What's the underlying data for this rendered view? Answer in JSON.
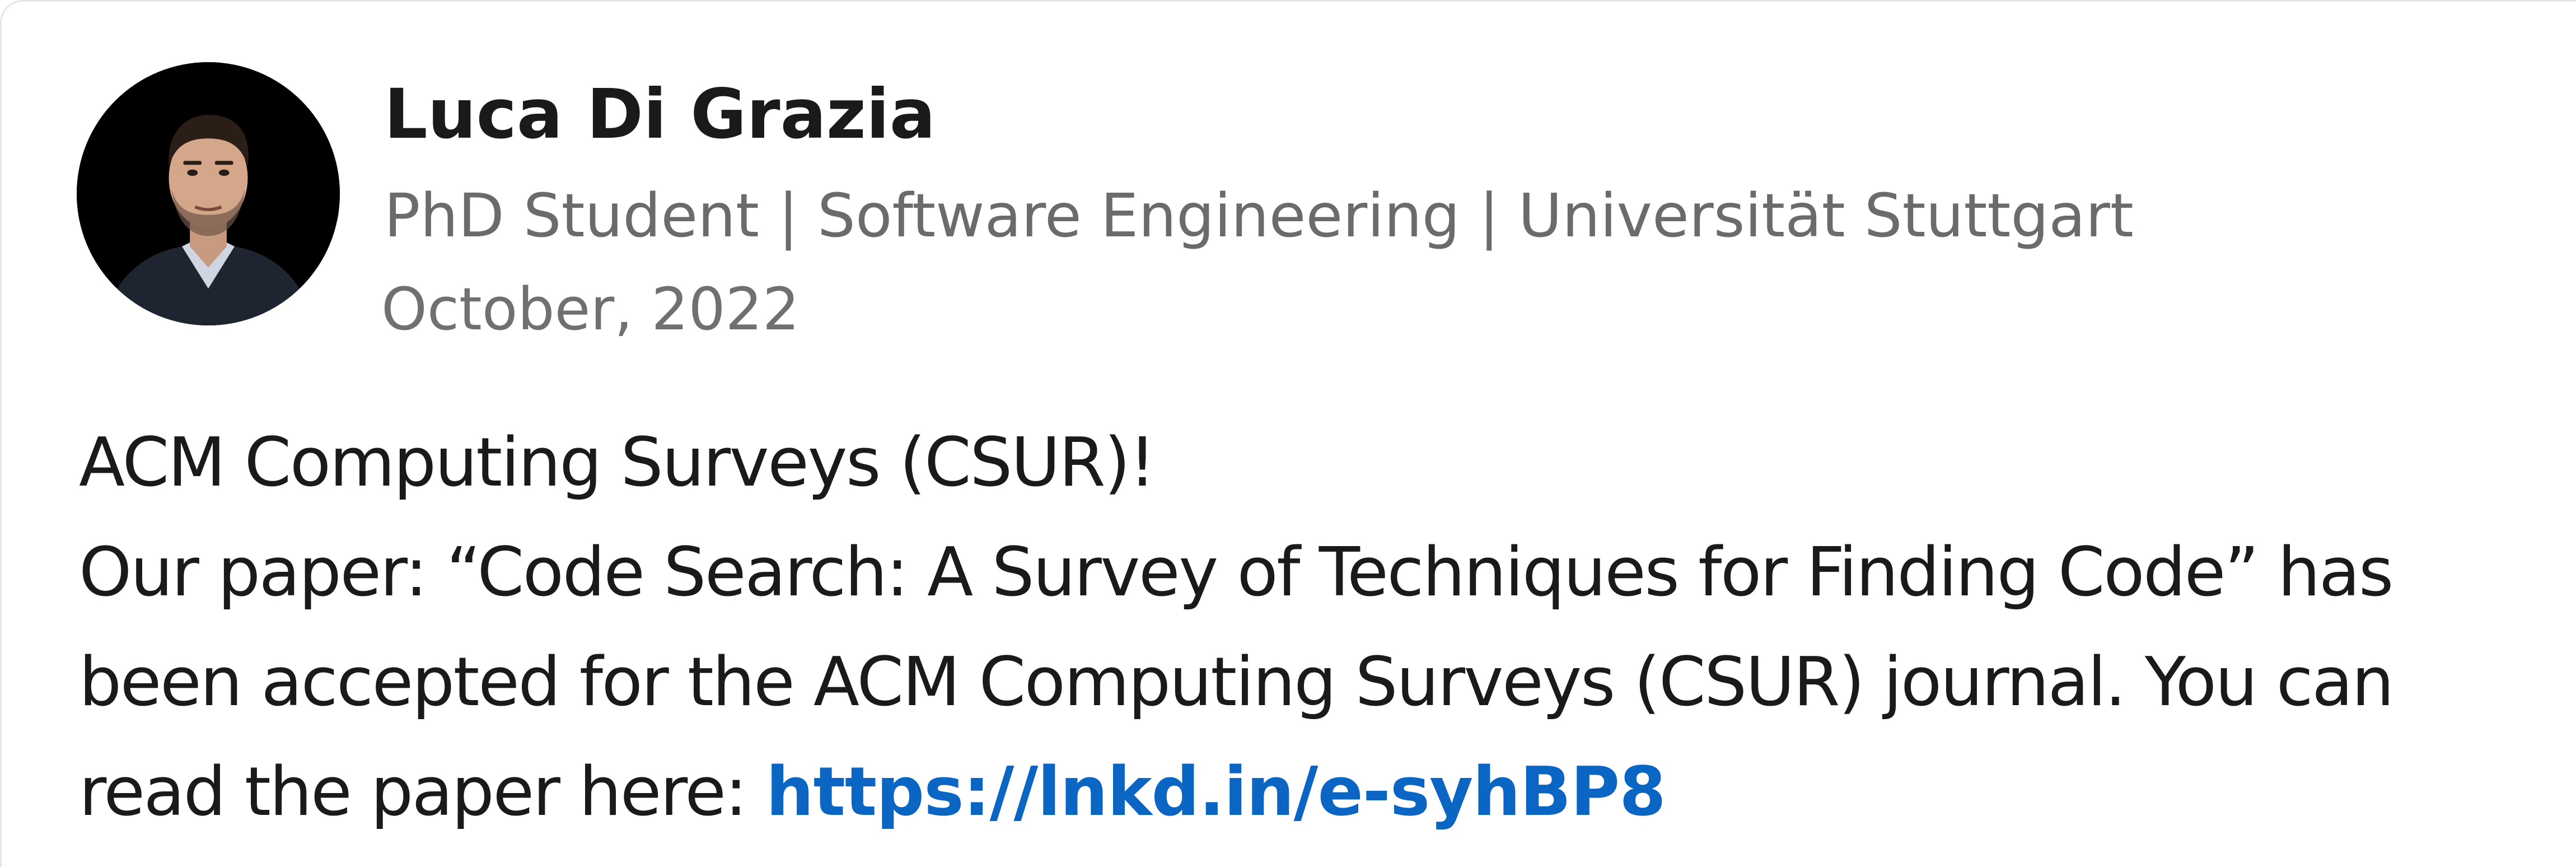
{
  "post": {
    "author": {
      "name": "Luca Di Grazia",
      "headline": "PhD Student | Software Engineering | Universität Stuttgart",
      "avatar_icon": "profile-photo"
    },
    "date": "October, 2022",
    "body": {
      "line1": "ACM Computing Surveys (CSUR)!",
      "line2": "Our paper: “Code Search: A Survey of Techniques for Finding Code” has",
      "line3": "been accepted for the ACM Computing Surveys (CSUR) journal. You can",
      "line4_prefix": "read the paper here: ",
      "link": "https://lnkd.in/e-syhBP8"
    },
    "colors": {
      "link": "#0a66c2",
      "text": "#1a1a1a",
      "muted": "#6b6b6b"
    }
  }
}
